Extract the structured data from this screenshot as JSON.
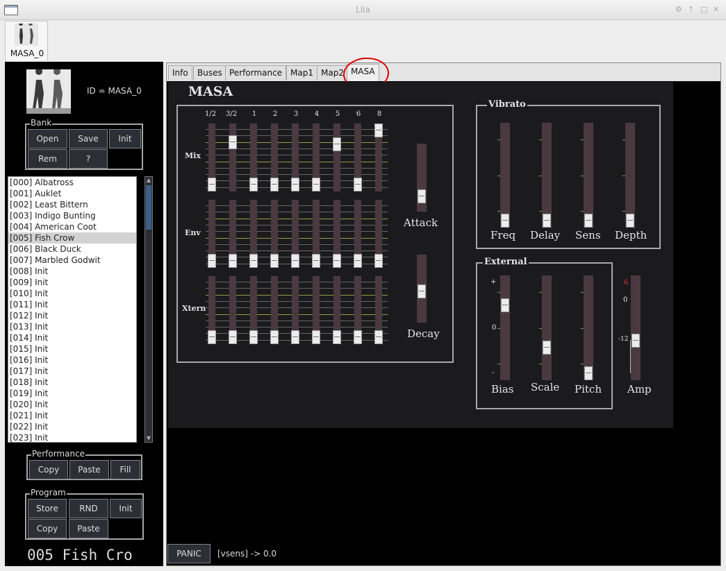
{
  "window": {
    "title": "Llia",
    "controls": [
      "⚙",
      "↑",
      "□",
      "✕"
    ]
  },
  "synth_tab": {
    "label": "MASA_0"
  },
  "left": {
    "id_text": "ID = MASA_0",
    "bank": {
      "label": "Bank",
      "open": "Open",
      "save": "Save",
      "init": "Init",
      "rem": "Rem",
      "help": "?"
    },
    "program_list": [
      "[000] Albatross",
      "[001] Auklet",
      "[002] Least Bittern",
      "[003] Indigo Bunting",
      "[004] American Coot",
      "[005] Fish Crow",
      "[006] Black Duck",
      "[007] Marbled Godwit",
      "[008] Init",
      "[009] Init",
      "[010] Init",
      "[011] Init",
      "[012] Init",
      "[013] Init",
      "[014] Init",
      "[015] Init",
      "[016] Init",
      "[017] Init",
      "[018] Init",
      "[019] Init",
      "[020] Init",
      "[021] Init",
      "[022] Init",
      "[023] Init"
    ],
    "selected_index": 5,
    "performance": {
      "label": "Performance",
      "copy": "Copy",
      "paste": "Paste",
      "fill": "Fill"
    },
    "program": {
      "label": "Program",
      "store": "Store",
      "rnd": "RND",
      "init": "Init",
      "copy": "Copy",
      "paste": "Paste"
    },
    "program_name_display": "005 Fish Cro"
  },
  "tabs": [
    "Info",
    "Buses",
    "Performance",
    "Map1",
    "Map2",
    "MASA"
  ],
  "active_tab": "MASA",
  "masa": {
    "title": "MASA",
    "harmonics": [
      "1/2",
      "3/2",
      "1",
      "2",
      "3",
      "4",
      "5",
      "6",
      "8"
    ],
    "rows": [
      {
        "label": "Mix",
        "levels": [
          0.0,
          0.78,
          0.0,
          0.0,
          0.0,
          0.0,
          0.75,
          0.0,
          1.0
        ]
      },
      {
        "label": "Env",
        "levels": [
          0,
          0,
          0,
          0,
          0,
          0,
          0,
          0,
          0
        ]
      },
      {
        "label": "Xtern",
        "levels": [
          0,
          0,
          0,
          0,
          0,
          0,
          0,
          0,
          0
        ]
      }
    ],
    "attack": {
      "label": "Attack",
      "level": 0.15
    },
    "decay": {
      "label": "Decay",
      "level": 0.45
    },
    "vibrato": {
      "label": "Vibrato",
      "sliders": [
        {
          "label": "Freq",
          "level": 0.0
        },
        {
          "label": "Delay",
          "level": 0.0
        },
        {
          "label": "Sens",
          "level": 0.0
        },
        {
          "label": "Depth",
          "level": 0.0
        }
      ]
    },
    "external": {
      "label": "External",
      "bias": {
        "label": "Bias",
        "level": 0.75,
        "marks": [
          "+",
          "0",
          "-"
        ]
      },
      "scale": {
        "label": "Scale",
        "level": 0.28
      },
      "pitch": {
        "label": "Pitch",
        "level": 0.0
      }
    },
    "amp": {
      "label": "Amp",
      "level": 0.36,
      "marks": [
        "6",
        "0",
        "-12"
      ]
    }
  },
  "status": {
    "panic": "PANIC",
    "message": "[vsens] -> 0.0"
  }
}
